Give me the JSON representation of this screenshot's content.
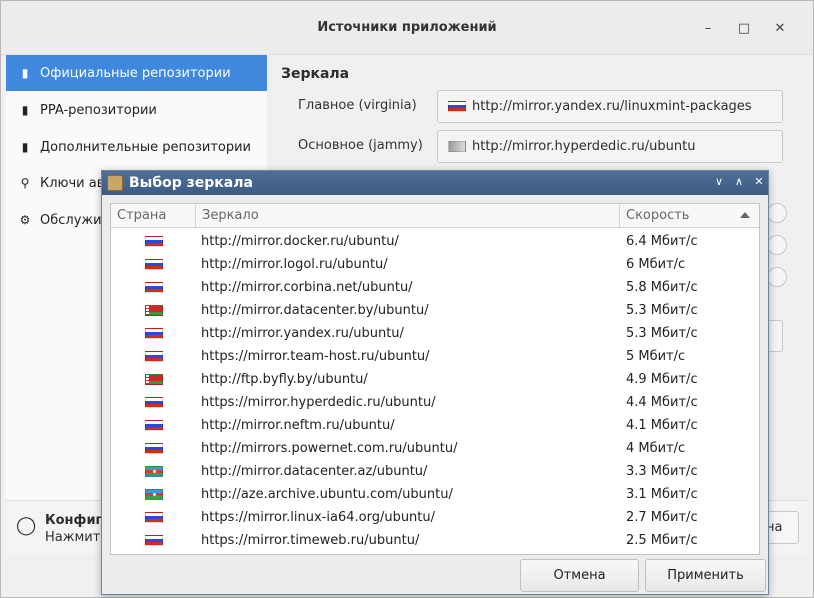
{
  "window": {
    "title": "Источники приложений"
  },
  "sidebar": {
    "items": [
      {
        "label": "Официальные репозитории",
        "icon": "package-icon"
      },
      {
        "label": "PPA-репозитории",
        "icon": "package-icon"
      },
      {
        "label": "Дополнительные репозитории",
        "icon": "package-icon"
      },
      {
        "label": "Ключи ав",
        "icon": "key-icon"
      },
      {
        "label": "Обслужи",
        "icon": "gear-icon"
      }
    ]
  },
  "main": {
    "section_title": "Зеркала",
    "main_label": "Главное (virginia)",
    "main_url": "http://mirror.yandex.ru/linuxmint-packages",
    "base_label": "Основное (jammy)",
    "base_url": "http://mirror.hyperdedic.ru/ubuntu"
  },
  "bottom": {
    "title_partial": "Конфиг",
    "text_partial": "Нажмит",
    "button_partial": "на"
  },
  "dialog": {
    "title": "Выбор зеркала",
    "columns": {
      "country": "Страна",
      "mirror": "Зеркало",
      "speed": "Скорость"
    },
    "rows": [
      {
        "flag": "ru",
        "url": "http://mirror.docker.ru/ubuntu/",
        "speed": "6.4 Мбит/с"
      },
      {
        "flag": "ru",
        "url": "http://mirror.logol.ru/ubuntu/",
        "speed": "6 Мбит/с"
      },
      {
        "flag": "ru",
        "url": "http://mirror.corbina.net/ubuntu/",
        "speed": "5.8 Мбит/с"
      },
      {
        "flag": "by",
        "url": "http://mirror.datacenter.by/ubuntu/",
        "speed": "5.3 Мбит/с"
      },
      {
        "flag": "ru",
        "url": "http://mirror.yandex.ru/ubuntu/",
        "speed": "5.3 Мбит/с"
      },
      {
        "flag": "ru",
        "url": "https://mirror.team-host.ru/ubuntu/",
        "speed": "5 Мбит/с"
      },
      {
        "flag": "by",
        "url": "http://ftp.byfly.by/ubuntu/",
        "speed": "4.9 Мбит/с"
      },
      {
        "flag": "ru",
        "url": "https://mirror.hyperdedic.ru/ubuntu/",
        "speed": "4.4 Мбит/с"
      },
      {
        "flag": "ru",
        "url": "http://mirror.neftm.ru/ubuntu/",
        "speed": "4.1 Мбит/с"
      },
      {
        "flag": "ru",
        "url": "http://mirrors.powernet.com.ru/ubuntu/",
        "speed": "4 Мбит/с"
      },
      {
        "flag": "az",
        "url": "http://mirror.datacenter.az/ubuntu/",
        "speed": "3.3 Мбит/с"
      },
      {
        "flag": "az",
        "url": "http://aze.archive.ubuntu.com/ubuntu/",
        "speed": "3.1 Мбит/с"
      },
      {
        "flag": "ru",
        "url": "https://mirror.linux-ia64.org/ubuntu/",
        "speed": "2.7 Мбит/с"
      },
      {
        "flag": "ru",
        "url": "https://mirror.timeweb.ru/ubuntu/",
        "speed": "2.5 Мбит/с"
      }
    ],
    "cancel_label": "Отмена",
    "apply_label": "Применить"
  }
}
